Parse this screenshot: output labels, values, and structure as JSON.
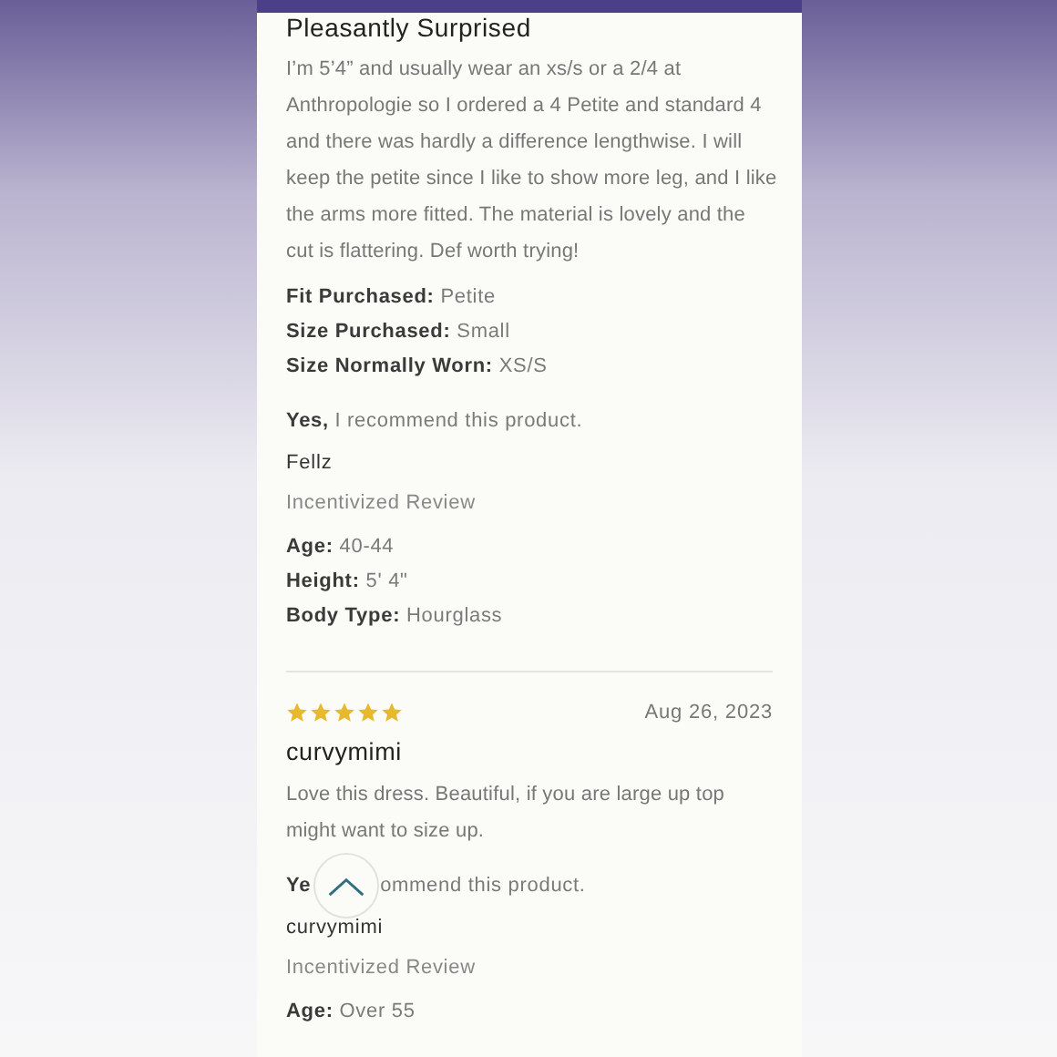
{
  "reviews": [
    {
      "title": "Pleasantly Surprised",
      "body": "I’m 5’4” and usually wear an xs/s or a 2/4 at Anthropologie so I ordered a 4 Petite and standard 4 and there was hardly a difference lengthwise. I will keep the petite since I like to show more leg, and I like the arms more fitted. The material is lovely and the cut is flattering. Def worth trying!",
      "details": [
        {
          "label": "Fit Purchased:",
          "value": "Petite"
        },
        {
          "label": "Size Purchased:",
          "value": "Small"
        },
        {
          "label": "Size Normally Worn:",
          "value": "XS/S"
        }
      ],
      "recommend": {
        "lead": "Yes,",
        "rest": "I recommend this product.",
        "covered_by_button": false
      },
      "reviewer": "Fellz",
      "badge": "Incentivized Review",
      "attributes": [
        {
          "label": "Age:",
          "value": "40-44"
        },
        {
          "label": "Height:",
          "value": "5' 4\""
        },
        {
          "label": "Body Type:",
          "value": "Hourglass"
        }
      ]
    },
    {
      "stars": 5,
      "date": "Aug 26, 2023",
      "title": "curvymimi",
      "body": "Love this dress. Beautiful, if you are large up top might want to size up.",
      "recommend": {
        "lead": "Ye",
        "rest": "ommend this product.",
        "covered_by_button": true
      },
      "reviewer": "curvymimi",
      "badge": "Incentivized Review",
      "attributes": [
        {
          "label": "Age:",
          "value": "Over 55"
        }
      ]
    }
  ]
}
